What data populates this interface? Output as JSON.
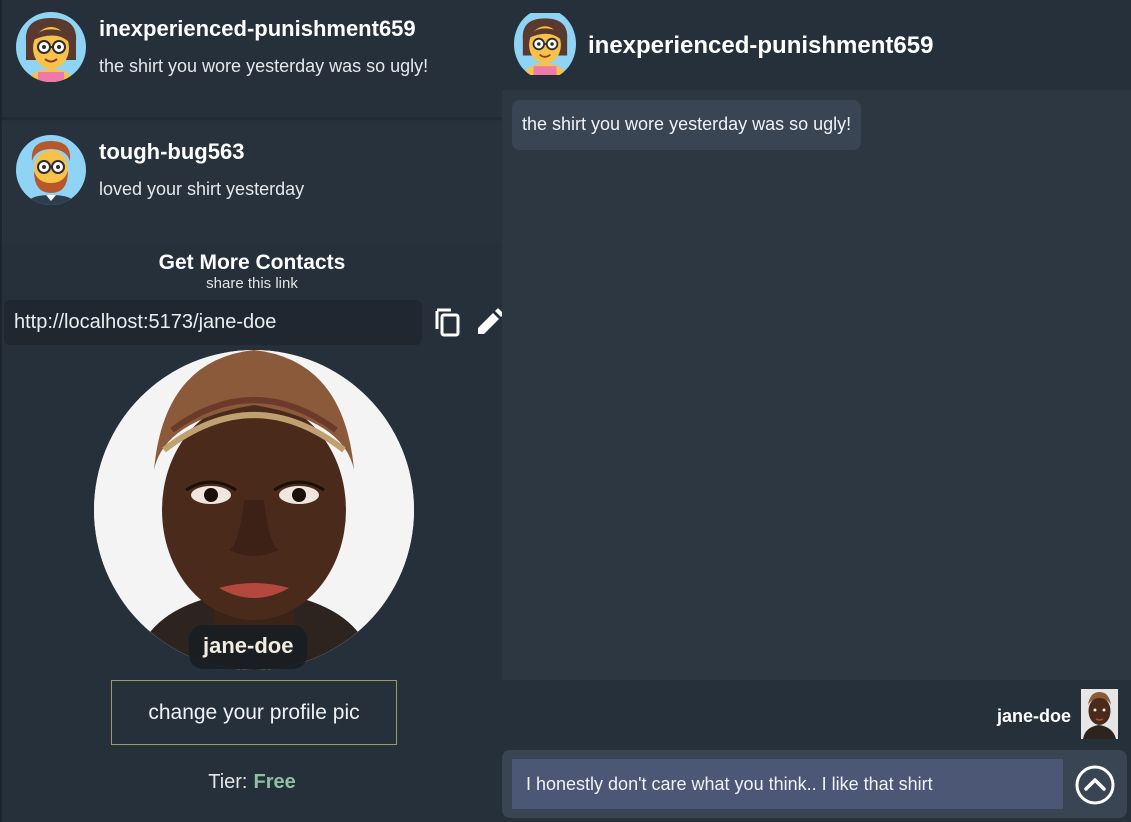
{
  "contacts": [
    {
      "username": "inexperienced-punishment659",
      "last_message": "the shirt you wore yesterday was so ugly!",
      "avatar": "cartoon-woman-glasses"
    },
    {
      "username": "tough-bug563",
      "last_message": "loved your shirt yesterday",
      "avatar": "cartoon-man-beard"
    }
  ],
  "share": {
    "title": "Get More Contacts",
    "subtitle": "share this link",
    "link": "http://localhost:5173/jane-doe",
    "copy_icon": "copy-icon",
    "edit_icon": "pencil-icon"
  },
  "profile": {
    "username": "jane-doe",
    "change_pic_label": "change your profile pic",
    "tier_label": "Tier:",
    "tier_value": "Free"
  },
  "chat": {
    "contact_name": "inexperienced-punishment659",
    "messages": [
      {
        "text": "the shirt you wore yesterday was so ugly!",
        "direction": "incoming"
      }
    ],
    "sender_name": "jane-doe",
    "input_value": "I honestly don't care what you think.. I like that shirt",
    "send_icon": "chevron-up-circle-icon"
  },
  "colors": {
    "tier_accent": "#8fc0a0",
    "input_bg": "#4b5774",
    "bubble_bg": "#3a4554"
  }
}
